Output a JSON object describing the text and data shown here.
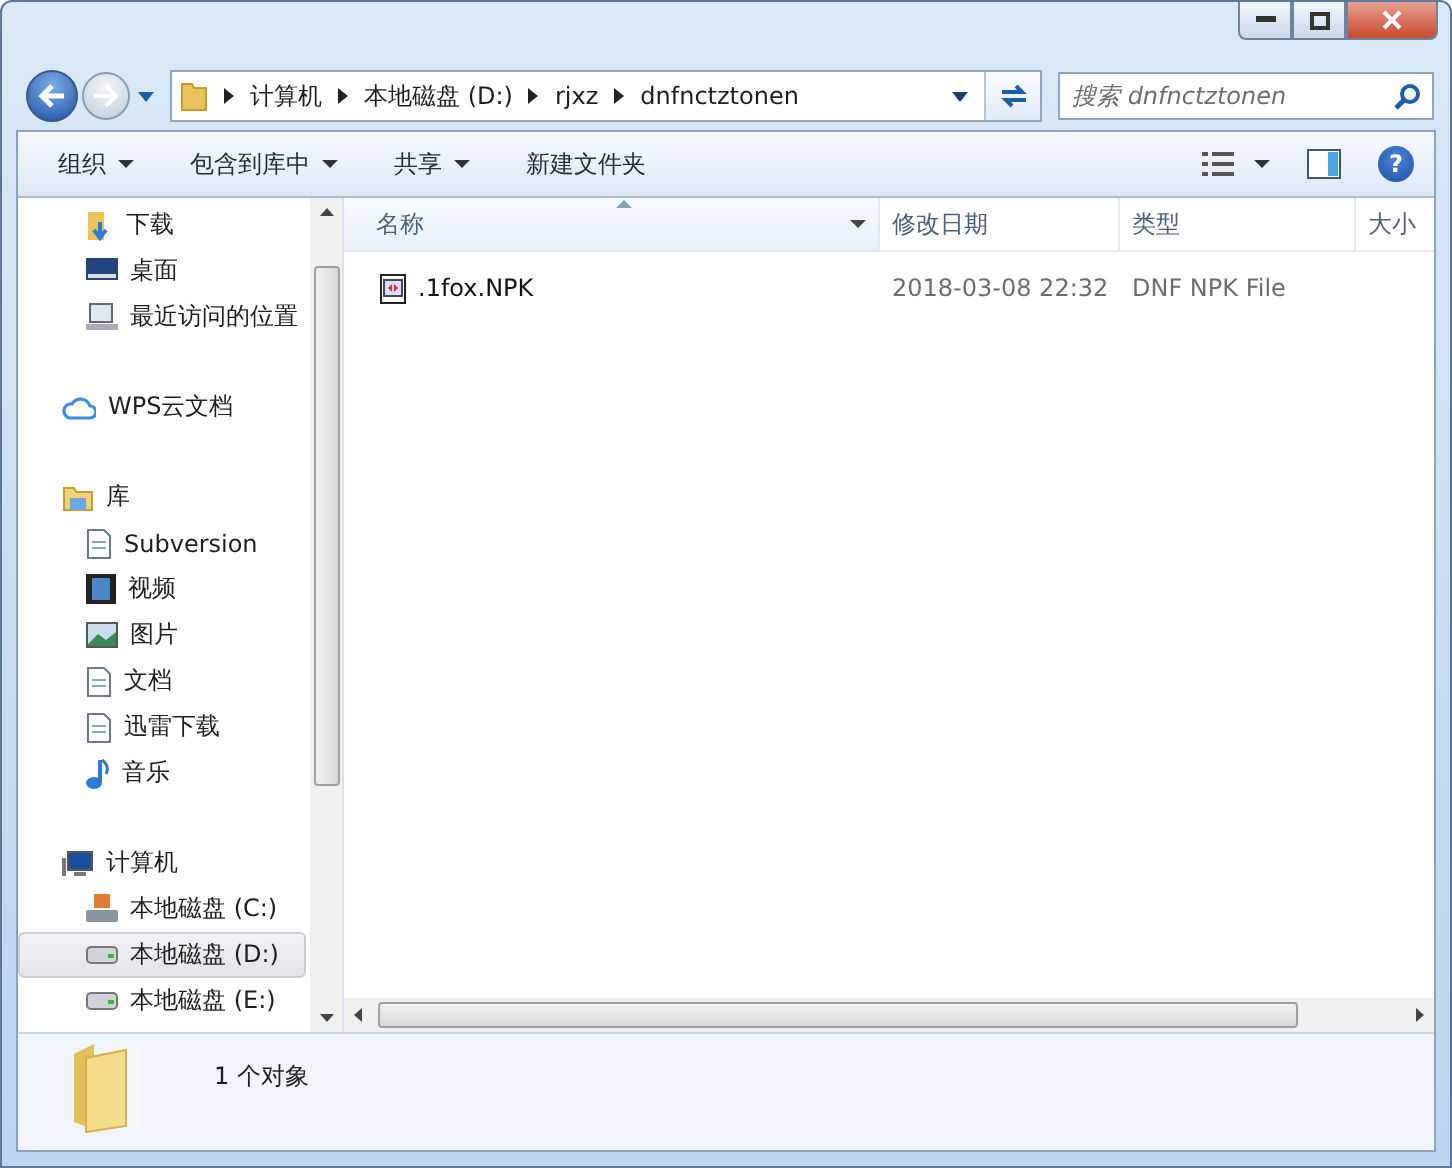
{
  "address_bar": {
    "segments": [
      "计算机",
      "本地磁盘 (D:)",
      "rjxz",
      "dnfnctztonen"
    ]
  },
  "search": {
    "placeholder": "搜索 dnfnctztonen"
  },
  "toolbar": {
    "buttons": [
      {
        "label": "组织",
        "dropdown": true
      },
      {
        "label": "包含到库中",
        "dropdown": true
      },
      {
        "label": "共享",
        "dropdown": true
      },
      {
        "label": "新建文件夹",
        "dropdown": false
      }
    ]
  },
  "sidebar": {
    "groups": [
      {
        "items": [
          {
            "label": "下载",
            "kind": "download",
            "selected": false
          },
          {
            "label": "桌面",
            "kind": "desktop",
            "selected": false
          },
          {
            "label": "最近访问的位置",
            "kind": "recent",
            "selected": false
          }
        ]
      },
      {
        "label": "WPS云文档",
        "kind": "cloud"
      },
      {
        "label": "库",
        "kind": "library",
        "items": [
          {
            "label": "Subversion",
            "kind": "doc",
            "selected": false
          },
          {
            "label": "视频",
            "kind": "video",
            "selected": false
          },
          {
            "label": "图片",
            "kind": "picture",
            "selected": false
          },
          {
            "label": "文档",
            "kind": "doc",
            "selected": false
          },
          {
            "label": "迅雷下载",
            "kind": "doc",
            "selected": false
          },
          {
            "label": "音乐",
            "kind": "music",
            "selected": false
          }
        ]
      },
      {
        "label": "计算机",
        "kind": "computer",
        "items": [
          {
            "label": "本地磁盘 (C:)",
            "kind": "sysdrive",
            "selected": false
          },
          {
            "label": "本地磁盘 (D:)",
            "kind": "drive",
            "selected": true
          },
          {
            "label": "本地磁盘 (E:)",
            "kind": "drive",
            "selected": false
          }
        ]
      }
    ]
  },
  "help_button": {
    "label": "?"
  },
  "table": {
    "columns": [
      "名称",
      "修改日期",
      "类型",
      "大小"
    ],
    "rows": [
      {
        "name": ".1fox.NPK",
        "modified": "2018-03-08 22:32",
        "type": "DNF NPK File"
      }
    ]
  },
  "status_bar": {
    "text": "1 个对象"
  }
}
